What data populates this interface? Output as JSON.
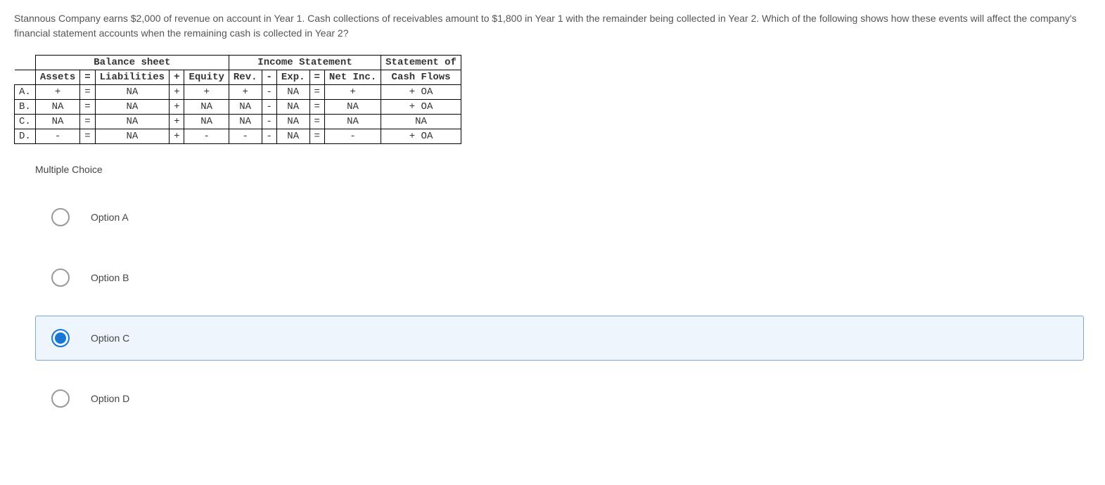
{
  "question": "Stannous Company earns $2,000 of revenue on account in Year 1. Cash collections of receivables amount to $1,800 in Year 1 with the remainder being collected in Year 2. Which of the following shows how these events will affect the company's financial statement accounts when the remaining cash is collected in Year 2?",
  "table": {
    "group_headers": {
      "balance_sheet": "Balance sheet",
      "income_statement": "Income Statement",
      "cashflow": "Statement of"
    },
    "col_headers": {
      "row_label": "",
      "assets": "Assets",
      "eq1": "=",
      "liabilities": "Liabilities",
      "plus1": "+",
      "equity": "Equity",
      "rev": "Rev.",
      "minus": "-",
      "exp": "Exp.",
      "eq2": "=",
      "netinc": "Net Inc.",
      "cashflow": "Cash Flows"
    },
    "rows": [
      {
        "label": "A.",
        "assets": "+",
        "eq1": "=",
        "liabilities": "NA",
        "plus1": "+",
        "equity": "+",
        "rev": "+",
        "minus": "-",
        "exp": "NA",
        "eq2": "=",
        "netinc": "+",
        "cashflow": "+ OA"
      },
      {
        "label": "B.",
        "assets": "NA",
        "eq1": "=",
        "liabilities": "NA",
        "plus1": "+",
        "equity": "NA",
        "rev": "NA",
        "minus": "-",
        "exp": "NA",
        "eq2": "=",
        "netinc": "NA",
        "cashflow": "+ OA"
      },
      {
        "label": "C.",
        "assets": "NA",
        "eq1": "=",
        "liabilities": "NA",
        "plus1": "+",
        "equity": "NA",
        "rev": "NA",
        "minus": "-",
        "exp": "NA",
        "eq2": "=",
        "netinc": "NA",
        "cashflow": "NA"
      },
      {
        "label": "D.",
        "assets": "-",
        "eq1": "=",
        "liabilities": "NA",
        "plus1": "+",
        "equity": "-",
        "rev": "-",
        "minus": "-",
        "exp": "NA",
        "eq2": "=",
        "netinc": "-",
        "cashflow": "+ OA"
      }
    ]
  },
  "mc_title": "Multiple Choice",
  "options": [
    {
      "label": "Option A",
      "selected": false
    },
    {
      "label": "Option B",
      "selected": false
    },
    {
      "label": "Option C",
      "selected": true
    },
    {
      "label": "Option D",
      "selected": false
    }
  ]
}
